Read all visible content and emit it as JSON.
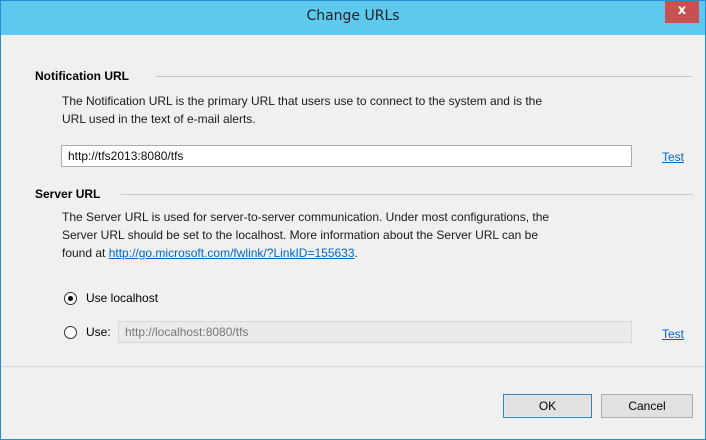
{
  "dialog": {
    "title": "Change URLs",
    "close_label": "x"
  },
  "notification": {
    "heading": "Notification URL",
    "description_line1": "The Notification URL is the primary URL that users use to connect to the system and is the",
    "description_line2": "URL used in the text of e-mail alerts.",
    "url_value": "http://tfs2013:8080/tfs",
    "test_label": "Test"
  },
  "server": {
    "heading": "Server URL",
    "description_line1": "The Server URL is used for server-to-server communication. Under most configurations, the",
    "description_line2": "Server URL should be set to the localhost. More information about the Server URL can be",
    "description_line3_prefix": "found at ",
    "info_link": "http://go.microsoft.com/fwlink/?LinkID=155633",
    "description_line3_suffix": ".",
    "option_localhost_label": "Use localhost",
    "option_localhost_selected": true,
    "option_use_label": "Use:",
    "option_use_selected": false,
    "use_value": "http://localhost:8080/tfs",
    "test_label": "Test"
  },
  "buttons": {
    "ok_label": "OK",
    "cancel_label": "Cancel"
  }
}
